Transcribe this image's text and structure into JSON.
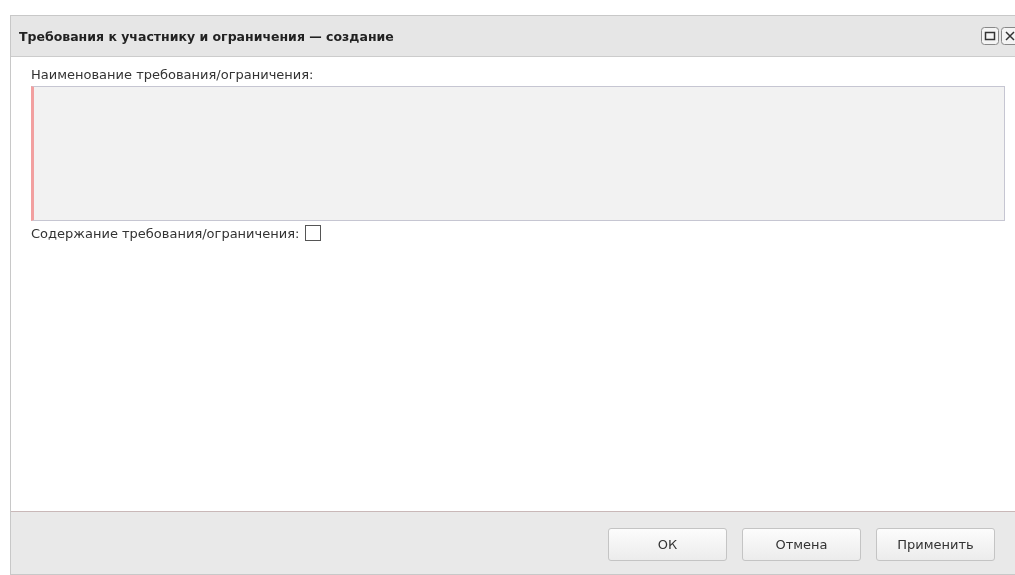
{
  "window": {
    "title": "Требования к участнику и ограничения — создание"
  },
  "fields": [
    {
      "kind": "textarea",
      "label": "Наименование требования/ограничения:",
      "required": true
    },
    {
      "kind": "checkbox",
      "label": "Содержание требования/ограничения:",
      "checked": false
    }
  ],
  "buttons": [
    "ОК",
    "Отмена",
    "Применить"
  ]
}
